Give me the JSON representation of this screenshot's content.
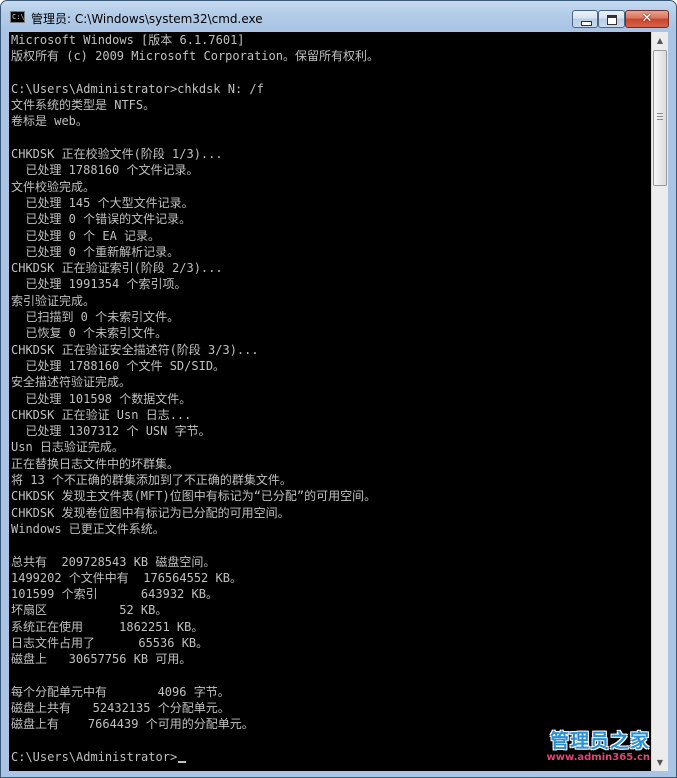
{
  "window": {
    "title": "管理员: C:\\Windows\\system32\\cmd.exe",
    "icon_name": "cmd-icon",
    "icon_text": "C:\\",
    "controls": {
      "minimize_icon": "minimize-icon",
      "maximize_icon": "maximize-icon",
      "close_icon": "close-icon",
      "close_glyph": "✕"
    },
    "colors": {
      "console_bg": "#000000",
      "console_fg": "#c0c0c0",
      "close_button": "#c7452b"
    }
  },
  "console": {
    "lines": [
      "Microsoft Windows [版本 6.1.7601]",
      "版权所有 (c) 2009 Microsoft Corporation。保留所有权利。",
      "",
      "C:\\Users\\Administrator>chkdsk N: /f",
      "文件系统的类型是 NTFS。",
      "卷标是 web。",
      "",
      "CHKDSK 正在校验文件(阶段 1/3)...",
      "  已处理 1788160 个文件记录。",
      "文件校验完成。",
      "  已处理 145 个大型文件记录。",
      "  已处理 0 个错误的文件记录。",
      "  已处理 0 个 EA 记录。",
      "  已处理 0 个重新解析记录。",
      "CHKDSK 正在验证索引(阶段 2/3)...",
      "  已处理 1991354 个索引项。",
      "索引验证完成。",
      "  已扫描到 0 个未索引文件。",
      "  已恢复 0 个未索引文件。",
      "CHKDSK 正在验证安全描述符(阶段 3/3)...",
      "  已处理 1788160 个文件 SD/SID。",
      "安全描述符验证完成。",
      "  已处理 101598 个数据文件。",
      "CHKDSK 正在验证 Usn 日志...",
      "  已处理 1307312 个 USN 字节。",
      "Usn 日志验证完成。",
      "正在替换日志文件中的坏群集。",
      "将 13 个不正确的群集添加到了不正确的群集文件。",
      "CHKDSK 发现主文件表(MFT)位图中有标记为“已分配”的可用空间。",
      "CHKDSK 发现卷位图中有标记为已分配的可用空间。",
      "Windows 已更正文件系统。",
      "",
      "总共有  209728543 KB 磁盘空间。",
      "1499202 个文件中有  176564552 KB。",
      "101599 个索引      643932 KB。",
      "坏扇区          52 KB。",
      "系统正在使用     1862251 KB。",
      "日志文件占用了      65536 KB。",
      "磁盘上   30657756 KB 可用。",
      "",
      "每个分配单元中有       4096 字节。",
      "磁盘上共有   52432135 个分配单元。",
      "磁盘上有    7664439 个可用的分配单元。",
      ""
    ],
    "prompt": "C:\\Users\\Administrator>"
  },
  "scrollbar": {
    "up_icon": "scroll-up-arrow-icon",
    "down_icon": "scroll-down-arrow-icon",
    "up_glyph": "▲",
    "down_glyph": "▼"
  },
  "watermark": {
    "brand": "管理员之家",
    "url": "www.admin365.cn",
    "colors": {
      "brand": "#2a8fd6",
      "url": "#e2457a"
    }
  }
}
